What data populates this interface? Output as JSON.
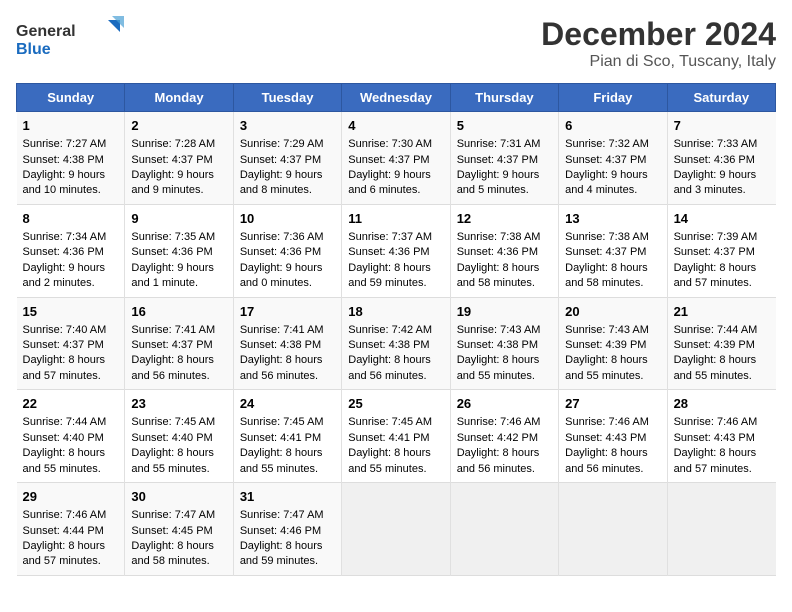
{
  "header": {
    "logo_general": "General",
    "logo_blue": "Blue",
    "title": "December 2024",
    "subtitle": "Pian di Sco, Tuscany, Italy"
  },
  "days_of_week": [
    "Sunday",
    "Monday",
    "Tuesday",
    "Wednesday",
    "Thursday",
    "Friday",
    "Saturday"
  ],
  "weeks": [
    [
      {
        "day": "1",
        "sunrise": "Sunrise: 7:27 AM",
        "sunset": "Sunset: 4:38 PM",
        "daylight": "Daylight: 9 hours and 10 minutes."
      },
      {
        "day": "2",
        "sunrise": "Sunrise: 7:28 AM",
        "sunset": "Sunset: 4:37 PM",
        "daylight": "Daylight: 9 hours and 9 minutes."
      },
      {
        "day": "3",
        "sunrise": "Sunrise: 7:29 AM",
        "sunset": "Sunset: 4:37 PM",
        "daylight": "Daylight: 9 hours and 8 minutes."
      },
      {
        "day": "4",
        "sunrise": "Sunrise: 7:30 AM",
        "sunset": "Sunset: 4:37 PM",
        "daylight": "Daylight: 9 hours and 6 minutes."
      },
      {
        "day": "5",
        "sunrise": "Sunrise: 7:31 AM",
        "sunset": "Sunset: 4:37 PM",
        "daylight": "Daylight: 9 hours and 5 minutes."
      },
      {
        "day": "6",
        "sunrise": "Sunrise: 7:32 AM",
        "sunset": "Sunset: 4:37 PM",
        "daylight": "Daylight: 9 hours and 4 minutes."
      },
      {
        "day": "7",
        "sunrise": "Sunrise: 7:33 AM",
        "sunset": "Sunset: 4:36 PM",
        "daylight": "Daylight: 9 hours and 3 minutes."
      }
    ],
    [
      {
        "day": "8",
        "sunrise": "Sunrise: 7:34 AM",
        "sunset": "Sunset: 4:36 PM",
        "daylight": "Daylight: 9 hours and 2 minutes."
      },
      {
        "day": "9",
        "sunrise": "Sunrise: 7:35 AM",
        "sunset": "Sunset: 4:36 PM",
        "daylight": "Daylight: 9 hours and 1 minute."
      },
      {
        "day": "10",
        "sunrise": "Sunrise: 7:36 AM",
        "sunset": "Sunset: 4:36 PM",
        "daylight": "Daylight: 9 hours and 0 minutes."
      },
      {
        "day": "11",
        "sunrise": "Sunrise: 7:37 AM",
        "sunset": "Sunset: 4:36 PM",
        "daylight": "Daylight: 8 hours and 59 minutes."
      },
      {
        "day": "12",
        "sunrise": "Sunrise: 7:38 AM",
        "sunset": "Sunset: 4:36 PM",
        "daylight": "Daylight: 8 hours and 58 minutes."
      },
      {
        "day": "13",
        "sunrise": "Sunrise: 7:38 AM",
        "sunset": "Sunset: 4:37 PM",
        "daylight": "Daylight: 8 hours and 58 minutes."
      },
      {
        "day": "14",
        "sunrise": "Sunrise: 7:39 AM",
        "sunset": "Sunset: 4:37 PM",
        "daylight": "Daylight: 8 hours and 57 minutes."
      }
    ],
    [
      {
        "day": "15",
        "sunrise": "Sunrise: 7:40 AM",
        "sunset": "Sunset: 4:37 PM",
        "daylight": "Daylight: 8 hours and 57 minutes."
      },
      {
        "day": "16",
        "sunrise": "Sunrise: 7:41 AM",
        "sunset": "Sunset: 4:37 PM",
        "daylight": "Daylight: 8 hours and 56 minutes."
      },
      {
        "day": "17",
        "sunrise": "Sunrise: 7:41 AM",
        "sunset": "Sunset: 4:38 PM",
        "daylight": "Daylight: 8 hours and 56 minutes."
      },
      {
        "day": "18",
        "sunrise": "Sunrise: 7:42 AM",
        "sunset": "Sunset: 4:38 PM",
        "daylight": "Daylight: 8 hours and 56 minutes."
      },
      {
        "day": "19",
        "sunrise": "Sunrise: 7:43 AM",
        "sunset": "Sunset: 4:38 PM",
        "daylight": "Daylight: 8 hours and 55 minutes."
      },
      {
        "day": "20",
        "sunrise": "Sunrise: 7:43 AM",
        "sunset": "Sunset: 4:39 PM",
        "daylight": "Daylight: 8 hours and 55 minutes."
      },
      {
        "day": "21",
        "sunrise": "Sunrise: 7:44 AM",
        "sunset": "Sunset: 4:39 PM",
        "daylight": "Daylight: 8 hours and 55 minutes."
      }
    ],
    [
      {
        "day": "22",
        "sunrise": "Sunrise: 7:44 AM",
        "sunset": "Sunset: 4:40 PM",
        "daylight": "Daylight: 8 hours and 55 minutes."
      },
      {
        "day": "23",
        "sunrise": "Sunrise: 7:45 AM",
        "sunset": "Sunset: 4:40 PM",
        "daylight": "Daylight: 8 hours and 55 minutes."
      },
      {
        "day": "24",
        "sunrise": "Sunrise: 7:45 AM",
        "sunset": "Sunset: 4:41 PM",
        "daylight": "Daylight: 8 hours and 55 minutes."
      },
      {
        "day": "25",
        "sunrise": "Sunrise: 7:45 AM",
        "sunset": "Sunset: 4:41 PM",
        "daylight": "Daylight: 8 hours and 55 minutes."
      },
      {
        "day": "26",
        "sunrise": "Sunrise: 7:46 AM",
        "sunset": "Sunset: 4:42 PM",
        "daylight": "Daylight: 8 hours and 56 minutes."
      },
      {
        "day": "27",
        "sunrise": "Sunrise: 7:46 AM",
        "sunset": "Sunset: 4:43 PM",
        "daylight": "Daylight: 8 hours and 56 minutes."
      },
      {
        "day": "28",
        "sunrise": "Sunrise: 7:46 AM",
        "sunset": "Sunset: 4:43 PM",
        "daylight": "Daylight: 8 hours and 57 minutes."
      }
    ],
    [
      {
        "day": "29",
        "sunrise": "Sunrise: 7:46 AM",
        "sunset": "Sunset: 4:44 PM",
        "daylight": "Daylight: 8 hours and 57 minutes."
      },
      {
        "day": "30",
        "sunrise": "Sunrise: 7:47 AM",
        "sunset": "Sunset: 4:45 PM",
        "daylight": "Daylight: 8 hours and 58 minutes."
      },
      {
        "day": "31",
        "sunrise": "Sunrise: 7:47 AM",
        "sunset": "Sunset: 4:46 PM",
        "daylight": "Daylight: 8 hours and 59 minutes."
      },
      null,
      null,
      null,
      null
    ]
  ]
}
